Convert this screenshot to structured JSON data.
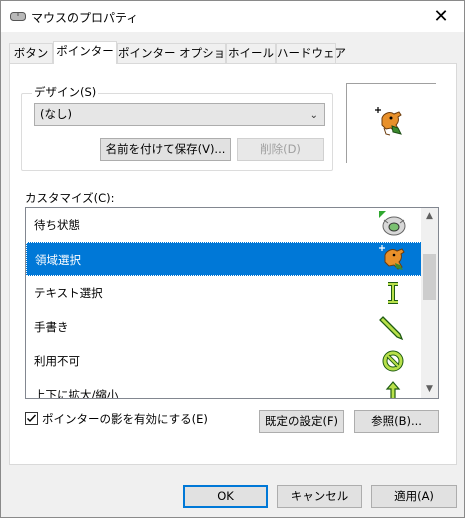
{
  "window": {
    "title": "マウスのプロパティ",
    "close_glyph": "✕"
  },
  "tabs": [
    {
      "label": "ボタン"
    },
    {
      "label": "ポインター",
      "active": true
    },
    {
      "label": "ポインター オプション"
    },
    {
      "label": "ホイール"
    },
    {
      "label": "ハードウェア"
    }
  ],
  "design": {
    "label": "デザイン(S)",
    "selected": "(なし)",
    "save_as_label": "名前を付けて保存(V)...",
    "delete_label": "削除(D)"
  },
  "customize": {
    "label": "カスタマイズ(C):",
    "items": [
      {
        "label": "待ち状態",
        "icon": "busy-cursor-icon"
      },
      {
        "label": "領域選択",
        "icon": "precision-select-icon",
        "selected": true
      },
      {
        "label": "テキスト選択",
        "icon": "text-select-icon"
      },
      {
        "label": "手書き",
        "icon": "handwriting-icon"
      },
      {
        "label": "利用不可",
        "icon": "unavailable-icon"
      },
      {
        "label": "上下に拡大/縮小",
        "icon": "vertical-resize-icon"
      }
    ]
  },
  "shadow": {
    "label": "ポインターの影を有効にする(E)",
    "checked": true
  },
  "buttons": {
    "default_label": "既定の設定(F)",
    "browse_label": "参照(B)...",
    "ok_label": "OK",
    "cancel_label": "キャンセル",
    "apply_label": "適用(A)"
  },
  "colors": {
    "selection": "#0078d7",
    "focus_border": "#0078d7"
  }
}
